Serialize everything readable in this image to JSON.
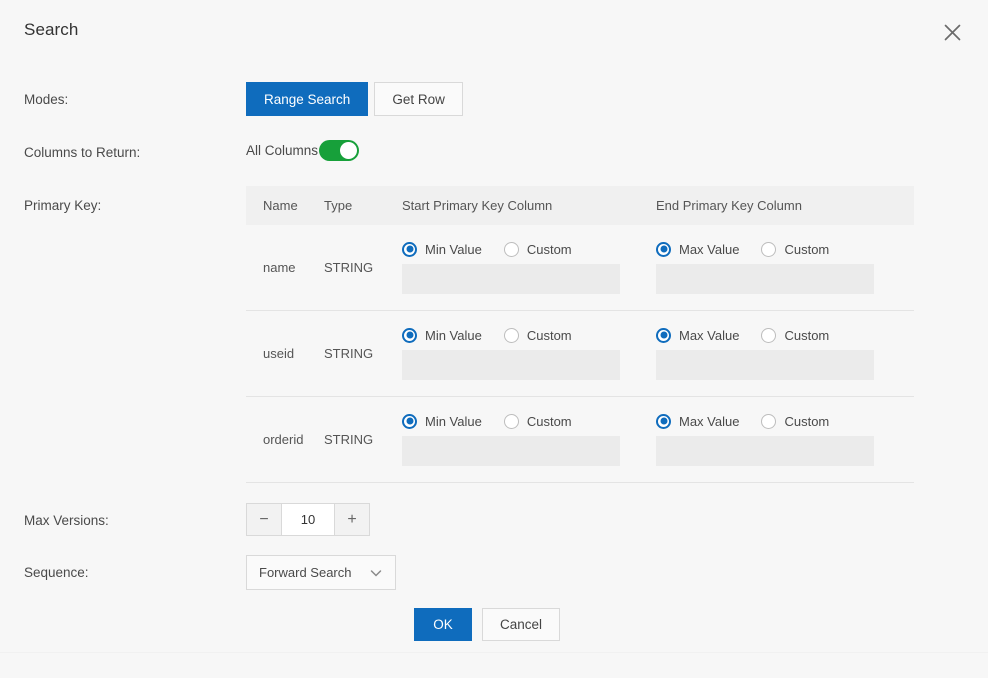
{
  "dialog": {
    "title": "Search",
    "close_icon": "close-icon"
  },
  "fields": {
    "modes_label": "Modes:",
    "columns_label": "Columns to Return:",
    "primary_key_label": "Primary Key:",
    "max_versions_label": "Max Versions:",
    "sequence_label": "Sequence:"
  },
  "modes": {
    "options": [
      {
        "label": "Range Search",
        "selected": true
      },
      {
        "label": "Get Row",
        "selected": false
      }
    ]
  },
  "columns_to_return": {
    "toggle_label": "All Columns",
    "toggle_on": true,
    "toggle_on_color": "#17a03a"
  },
  "primary_key_table": {
    "headers": {
      "name": "Name",
      "type": "Type",
      "start": "Start Primary Key Column",
      "end": "End Primary Key Column"
    },
    "rows": [
      {
        "name": "name",
        "type": "STRING",
        "start": {
          "preset_label": "Min Value",
          "preset_selected": true,
          "custom_label": "Custom",
          "custom_selected": false,
          "input_value": ""
        },
        "end": {
          "preset_label": "Max Value",
          "preset_selected": true,
          "custom_label": "Custom",
          "custom_selected": false,
          "input_value": ""
        }
      },
      {
        "name": "useid",
        "type": "STRING",
        "start": {
          "preset_label": "Min Value",
          "preset_selected": true,
          "custom_label": "Custom",
          "custom_selected": false,
          "input_value": ""
        },
        "end": {
          "preset_label": "Max Value",
          "preset_selected": true,
          "custom_label": "Custom",
          "custom_selected": false,
          "input_value": ""
        }
      },
      {
        "name": "orderid",
        "type": "STRING",
        "start": {
          "preset_label": "Min Value",
          "preset_selected": true,
          "custom_label": "Custom",
          "custom_selected": false,
          "input_value": ""
        },
        "end": {
          "preset_label": "Max Value",
          "preset_selected": true,
          "custom_label": "Custom",
          "custom_selected": false,
          "input_value": ""
        }
      }
    ]
  },
  "max_versions": {
    "decrement_label": "−",
    "value": "10",
    "increment_label": "+"
  },
  "sequence": {
    "value": "Forward Search",
    "caret_icon": "chevron-down-icon"
  },
  "footer": {
    "ok_label": "OK",
    "cancel_label": "Cancel"
  },
  "theme": {
    "accent": "#0f6cbd",
    "toggle_green": "#17a03a",
    "background": "#f7f7f7"
  }
}
